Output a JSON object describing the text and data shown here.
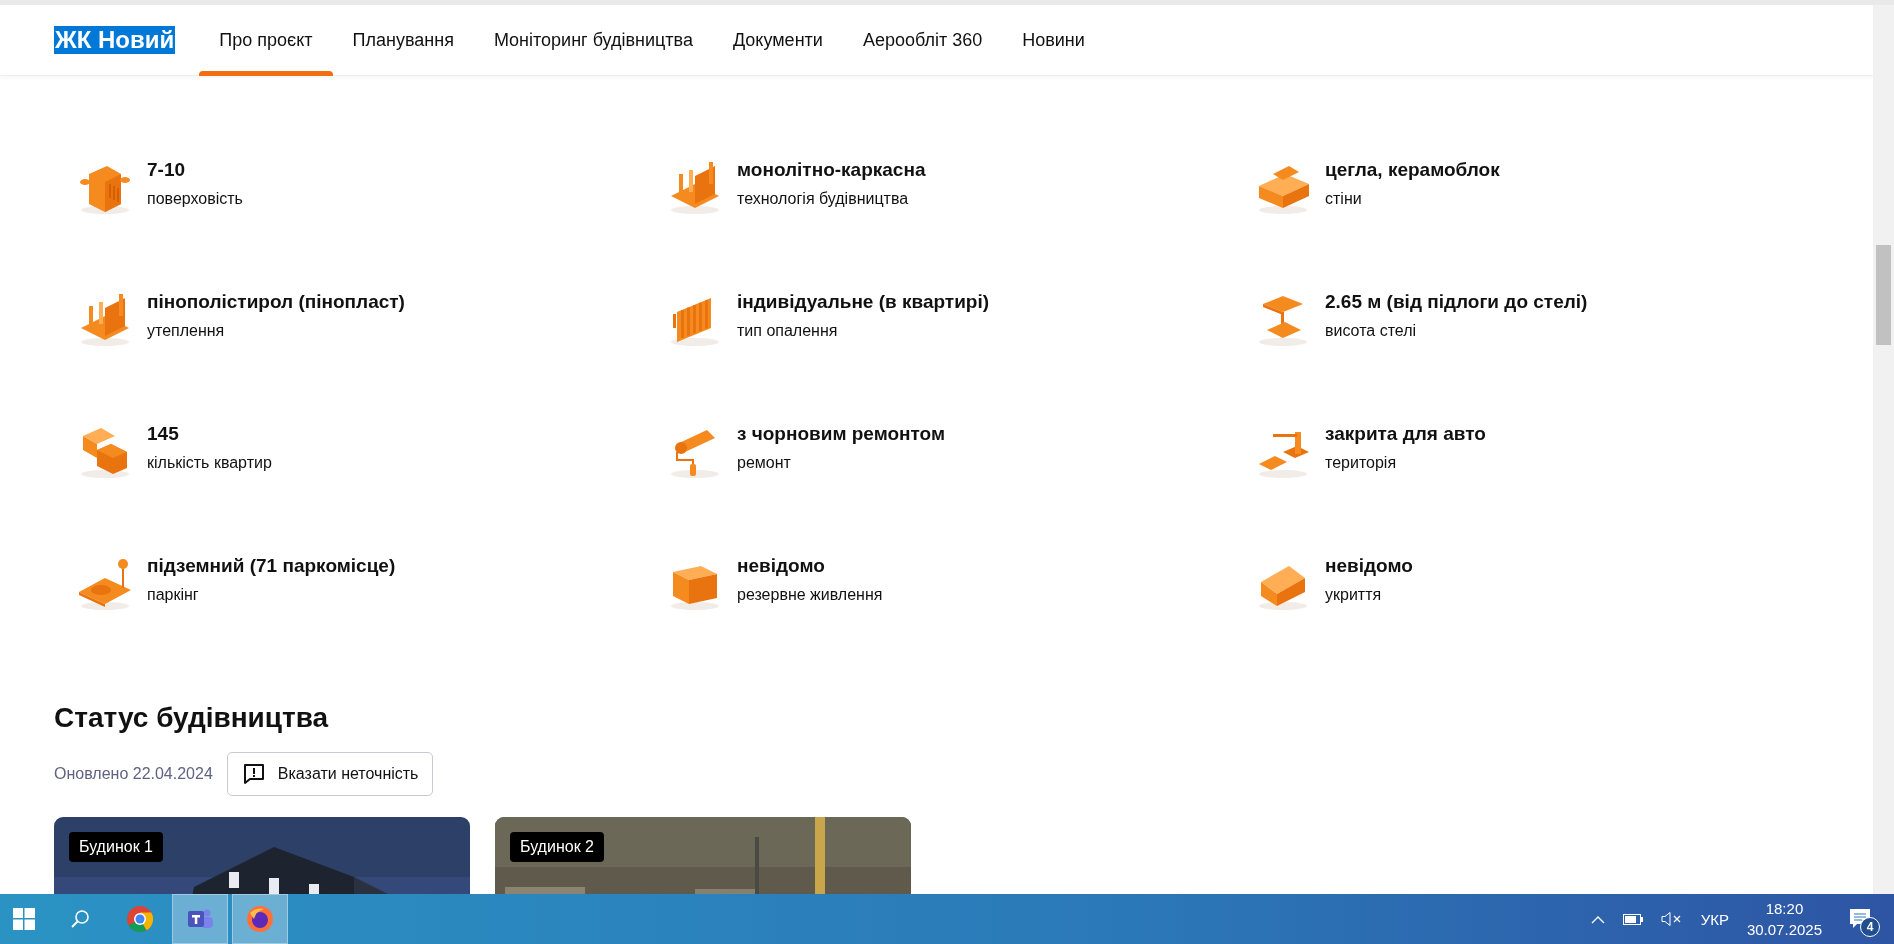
{
  "header": {
    "logo": "ЖК Новий",
    "logo_highlighted": true,
    "tabs": [
      {
        "label": "Про проєкт",
        "selected": true
      },
      {
        "label": "Планування",
        "selected": false
      },
      {
        "label": "Моніторинг будівництва",
        "selected": false
      },
      {
        "label": "Документи",
        "selected": false
      },
      {
        "label": "Аерообліт 360",
        "selected": false
      },
      {
        "label": "Новини",
        "selected": false
      }
    ]
  },
  "features": [
    {
      "kind": "building",
      "value": "7-10",
      "label": "поверховість"
    },
    {
      "kind": "frame",
      "value": "монолітно-каркасна",
      "label": "технологія будівництва"
    },
    {
      "kind": "bricks",
      "value": "цегла, керамоблок",
      "label": "стіни"
    },
    {
      "kind": "frame",
      "value": "пінополістирол (пінопласт)",
      "label": "утеплення"
    },
    {
      "kind": "radiator",
      "value": "індивідуальне (в квартирі)",
      "label": "тип опалення"
    },
    {
      "kind": "platform",
      "value": "2.65 м (від підлоги до стелі)",
      "label": "висота стелі"
    },
    {
      "kind": "rooms",
      "value": "145",
      "label": "кількість квартир"
    },
    {
      "kind": "roller",
      "value": "з чорновим ремонтом",
      "label": "ремонт"
    },
    {
      "kind": "barrier",
      "value": "закрита для авто",
      "label": "територія"
    },
    {
      "kind": "parking",
      "value": "підземний (71 паркомісце)",
      "label": "паркінг"
    },
    {
      "kind": "crate",
      "value": "невідомо",
      "label": "резервне живлення"
    },
    {
      "kind": "house",
      "value": "невідомо",
      "label": "укриття"
    }
  ],
  "status": {
    "title": "Статус будівництва",
    "updated": "Оновлено 22.04.2024",
    "report_button": "Вказати неточність",
    "cards": [
      {
        "label": "Будинок 1",
        "kind": "picture"
      },
      {
        "label": "Будинок 2",
        "kind": "picture"
      }
    ]
  },
  "taskbar": {
    "apps": [
      {
        "kind": "chrome",
        "open": false
      },
      {
        "kind": "teams",
        "open": true
      },
      {
        "kind": "firefox",
        "open": true
      }
    ],
    "language": "УКР",
    "time": "18:20",
    "date": "30.07.2025",
    "notifications": "4"
  }
}
